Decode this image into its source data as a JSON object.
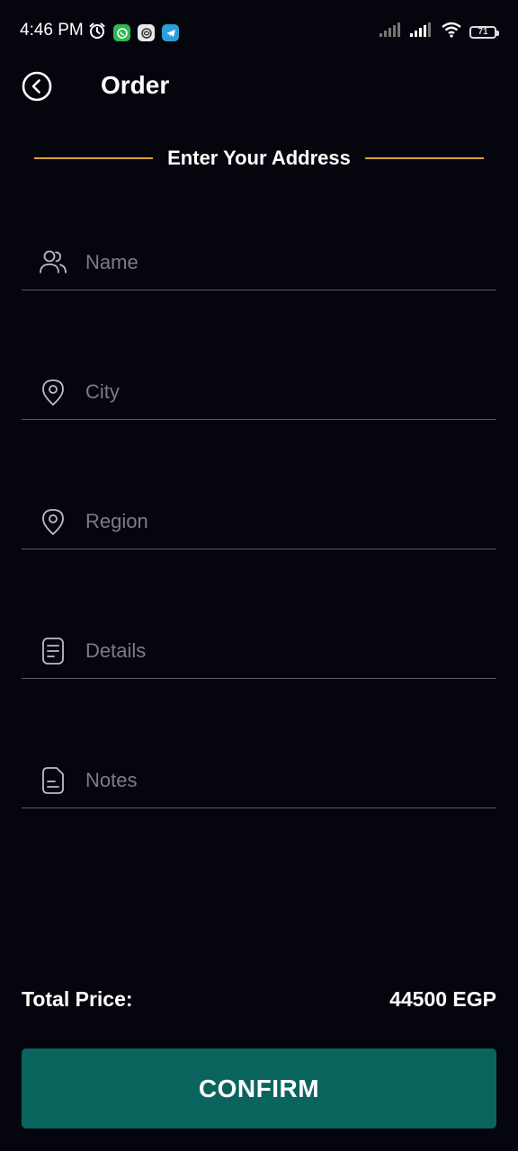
{
  "status_bar": {
    "time": "4:46 PM",
    "battery": "71",
    "icons": [
      "alarm-icon",
      "whatsapp-icon",
      "app-icon",
      "telegram-icon",
      "signal-icon",
      "signal-icon",
      "wifi-icon",
      "battery-icon"
    ]
  },
  "header": {
    "title": "Order",
    "back_icon": "back-arrow-icon"
  },
  "section": {
    "title": "Enter Your Address",
    "accent_color": "#d9a23b"
  },
  "form": {
    "fields": [
      {
        "placeholder": "Name",
        "value": "",
        "icon": "users-icon"
      },
      {
        "placeholder": "City",
        "value": "",
        "icon": "location-pin-icon"
      },
      {
        "placeholder": "Region",
        "value": "",
        "icon": "location-pin-icon"
      },
      {
        "placeholder": "Details",
        "value": "",
        "icon": "document-icon"
      },
      {
        "placeholder": "Notes",
        "value": "",
        "icon": "note-icon"
      }
    ]
  },
  "summary": {
    "total_label": "Total Price:",
    "total_value": "44500 EGP"
  },
  "actions": {
    "confirm_label": "CONFIRM",
    "confirm_color": "#0a645e"
  }
}
